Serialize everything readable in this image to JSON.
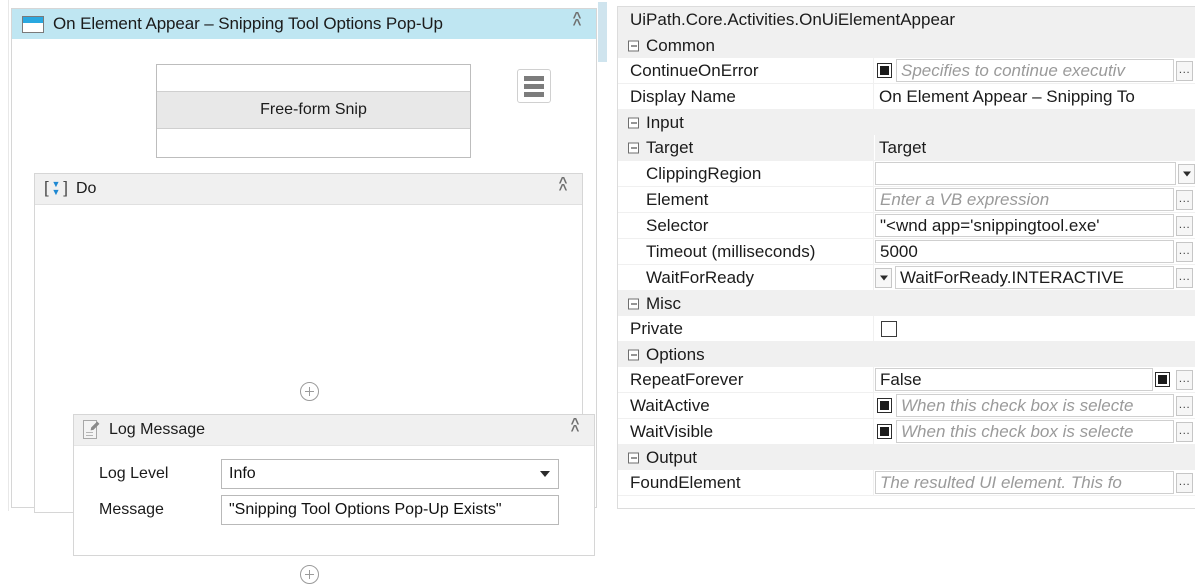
{
  "designer": {
    "activity": {
      "title": "On Element Appear – Snipping Tool Options Pop-Up",
      "icon": "window-icon",
      "collapse_icon": "double-chevron-up-icon",
      "menu_icon": "hamburger-menu-icon",
      "target_preview": {
        "selected_item": "Free-form Snip"
      }
    },
    "do_container": {
      "title": "Do",
      "icon": "sequence-icon",
      "collapse_icon": "double-chevron-up-icon",
      "add_top_label": "+",
      "add_bottom_label": "+"
    },
    "log_message": {
      "title": "Log Message",
      "icon": "log-message-icon",
      "collapse_icon": "double-chevron-up-icon",
      "fields": [
        {
          "label": "Log Level",
          "value": "Info",
          "control": "combobox"
        },
        {
          "label": "Message",
          "value": "\"Snipping Tool Options Pop-Up Exists\"",
          "control": "textbox"
        }
      ]
    }
  },
  "properties": {
    "type_name": "UiPath.Core.Activities.OnUiElementAppear",
    "categories": [
      {
        "name": "Common",
        "rows": [
          {
            "label": "ContinueOnError",
            "value": "Specifies to continue executiv",
            "is_hint": true,
            "checkbox": "filled",
            "ellipsis": true
          },
          {
            "label": "Display Name",
            "value": "On Element Appear – Snipping To",
            "is_hint": false,
            "plain": true
          }
        ]
      },
      {
        "name": "Input",
        "rows": []
      },
      {
        "name": "Target",
        "is_subcategory": true,
        "header_value": "Target",
        "rows": [
          {
            "label": "ClippingRegion",
            "value": "",
            "is_hint": false,
            "dropdown": true
          },
          {
            "label": "Element",
            "value": "Enter a VB expression",
            "is_hint": true,
            "ellipsis": true
          },
          {
            "label": "Selector",
            "value": "\"<wnd app='snippingtool.exe'",
            "is_hint": false,
            "ellipsis": true
          },
          {
            "label": "Timeout (milliseconds)",
            "value": "5000",
            "is_hint": false,
            "ellipsis": true
          },
          {
            "label": "WaitForReady",
            "value": "WaitForReady.INTERACTIVE",
            "is_hint": false,
            "leading_dropdown": true,
            "ellipsis": true
          }
        ]
      },
      {
        "name": "Misc",
        "rows": [
          {
            "label": "Private",
            "value": "",
            "is_hint": false,
            "checkbox": "empty"
          }
        ]
      },
      {
        "name": "Options",
        "rows": [
          {
            "label": "RepeatForever",
            "value": "False",
            "is_hint": false,
            "trailing_checkbox": "filled",
            "ellipsis": true
          },
          {
            "label": "WaitActive",
            "value": "When this check box is selecte",
            "is_hint": true,
            "checkbox": "filled",
            "ellipsis": true
          },
          {
            "label": "WaitVisible",
            "value": "When this check box is selecte",
            "is_hint": true,
            "checkbox": "filled",
            "ellipsis": true
          }
        ]
      },
      {
        "name": "Output",
        "rows": [
          {
            "label": "FoundElement",
            "value": "The resulted UI element. This fo",
            "is_hint": true,
            "ellipsis": true
          }
        ]
      }
    ]
  },
  "colors": {
    "activity_header": "#bfe6f2",
    "section_header": "#f0f0f0",
    "accent_blue": "#29a8e0",
    "border": "#d6d6d6"
  }
}
